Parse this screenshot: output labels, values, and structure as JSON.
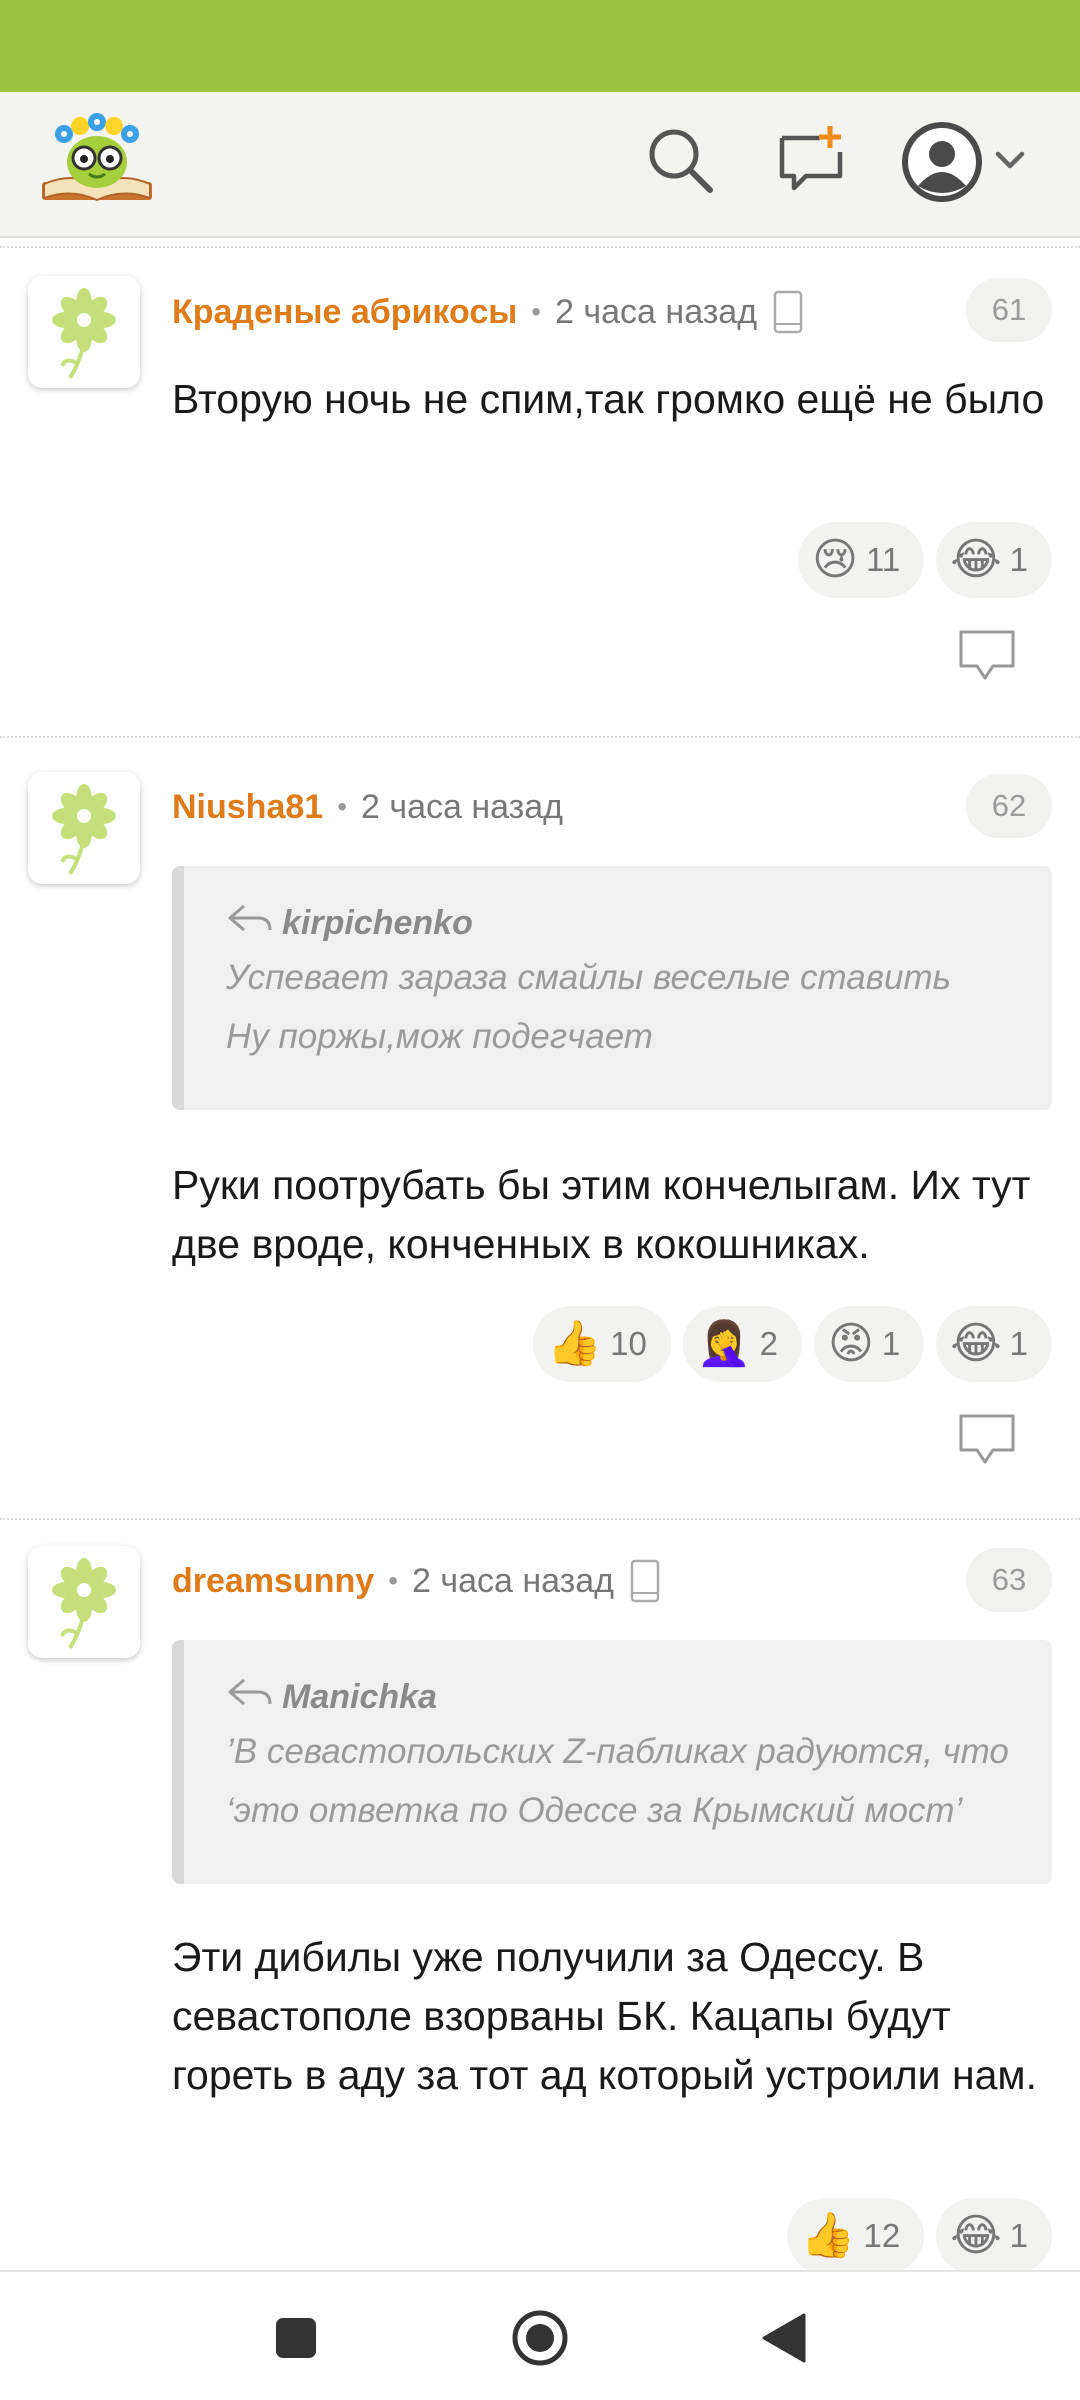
{
  "header": {
    "logo_icon": "book-flower-logo-icon",
    "search_icon": "search-icon",
    "new_post_icon": "add-chat-icon",
    "profile_icon": "user-avatar-icon",
    "menu_icon": "chevron-down-icon",
    "colors": {
      "status_bar": "#9dc242",
      "header_bg": "#f3f3f0"
    }
  },
  "comments": [
    {
      "author": "Краденые абрикосы",
      "time": "2 часа назад",
      "device_icon": "mobile-phone-icon",
      "number": "61",
      "text": "Вторую ночь не спим,так громко ещё не было",
      "reactions": [
        {
          "emoji": "😢",
          "count": "11"
        },
        {
          "emoji": "😂",
          "count": "1"
        }
      ]
    },
    {
      "author": "Niusha81",
      "time": "2 часа назад",
      "number": "62",
      "quote": {
        "author": "kirpichenko",
        "lines": [
          "Успевает зараза смайлы веселые ставить",
          "Ну поржы,мож подегчает"
        ]
      },
      "text": "Руки поотрубать бы этим кончелыгам. Их тут две вроде, конченных в кокошниках.",
      "reactions": [
        {
          "emoji": "👍",
          "count": "10"
        },
        {
          "emoji": "🤦‍♀️",
          "count": "2"
        },
        {
          "emoji": "😡",
          "count": "1"
        },
        {
          "emoji": "😂",
          "count": "1"
        }
      ]
    },
    {
      "author": "dreamsunny",
      "time": "2 часа назад",
      "device_icon": "mobile-phone-icon",
      "number": "63",
      "quote": {
        "author": "Manichka",
        "lines": [
          "’В севастопольских Z-пабликах радуются, что",
          "‘это ответка по Одессе за Крымский мост’"
        ]
      },
      "text": "Эти дибилы уже получили за Одессу. В севастополе взорваны БК. Кацапы будут гореть в аду за тот ад который устроили нам.",
      "reactions": [
        {
          "emoji": "👍",
          "count": "12"
        },
        {
          "emoji": "😂",
          "count": "1"
        }
      ]
    }
  ],
  "navbar": {
    "recents_icon": "square-recents-icon",
    "home_icon": "circle-home-icon",
    "back_icon": "triangle-back-icon"
  }
}
